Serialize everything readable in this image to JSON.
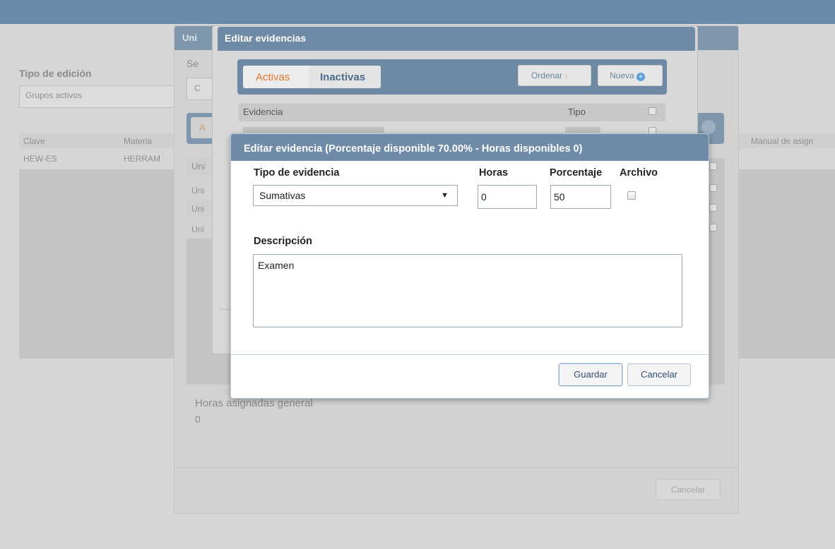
{
  "background": {
    "tipo_label": "Tipo de edición",
    "tipo_value": "Grupos activos",
    "table_headers": [
      "Clave",
      "Materia",
      "Manual de asign"
    ],
    "row": [
      "HEW-ES",
      "HERRAM"
    ],
    "horas_label": "Horas asignadas general",
    "horas_value": "0",
    "cancel_label": "Cancelar"
  },
  "unidades_modal": {
    "title_fragment": "Uni",
    "label_fragment": "Se",
    "select_fragment": "C",
    "tab_fragment": "A",
    "rows": [
      "Uni",
      "Uni",
      "Uni",
      "Uni"
    ]
  },
  "evidencias_modal": {
    "title": "Editar evidencias",
    "tabs": [
      "Activas",
      "Inactivas"
    ],
    "order_label": "Ordenar",
    "order_icon": "sort-icon",
    "new_label": "Nueva",
    "new_icon": "plus-circle-icon",
    "columns": [
      "Evidencia",
      "Tipo"
    ]
  },
  "evidencia_dialog": {
    "title": "Editar evidencia (Porcentaje disponible 70.00% - Horas disponibles 0)",
    "tipo_label": "Tipo de evidencia",
    "tipo_value": "Sumativas",
    "horas_label": "Horas",
    "horas_value": "0",
    "porcentaje_label": "Porcentaje",
    "porcentaje_value": "50",
    "archivo_label": "Archivo",
    "archivo_checked": false,
    "descripcion_label": "Descripción",
    "descripcion_value": "Examen",
    "save_label": "Guardar",
    "cancel_label": "Cancelar"
  },
  "colors": {
    "header_blue": "#6f8ba8",
    "tab_active": "#e5762a",
    "tab_inactive": "#4d6b8c"
  }
}
